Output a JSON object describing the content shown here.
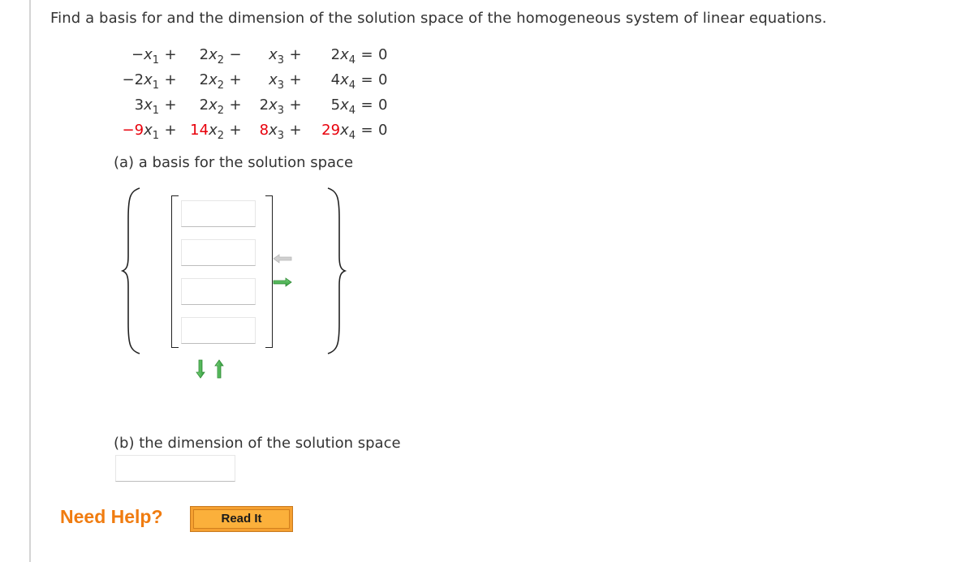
{
  "question": "Find a basis for and the dimension of the solution space of the homogeneous system of linear equations.",
  "equations": [
    {
      "terms": [
        {
          "coef": "−",
          "var": "x",
          "sub": "1",
          "red": false
        },
        {
          "op": "+",
          "coef": "2",
          "var": "x",
          "sub": "2",
          "red": false
        },
        {
          "op": "−",
          "coef": "",
          "var": "x",
          "sub": "3",
          "red": false
        },
        {
          "op": "+",
          "coef": "2",
          "var": "x",
          "sub": "4",
          "red": false
        }
      ],
      "rhs": "0"
    },
    {
      "terms": [
        {
          "coef": "−2",
          "var": "x",
          "sub": "1",
          "red": false
        },
        {
          "op": "+",
          "coef": "2",
          "var": "x",
          "sub": "2",
          "red": false
        },
        {
          "op": "+",
          "coef": "",
          "var": "x",
          "sub": "3",
          "red": false
        },
        {
          "op": "+",
          "coef": "4",
          "var": "x",
          "sub": "4",
          "red": false
        }
      ],
      "rhs": "0"
    },
    {
      "terms": [
        {
          "coef": "3",
          "var": "x",
          "sub": "1",
          "red": false
        },
        {
          "op": "+",
          "coef": "2",
          "var": "x",
          "sub": "2",
          "red": false
        },
        {
          "op": "+",
          "coef": "2",
          "var": "x",
          "sub": "3",
          "red": false
        },
        {
          "op": "+",
          "coef": "5",
          "var": "x",
          "sub": "4",
          "red": false
        }
      ],
      "rhs": "0"
    },
    {
      "terms": [
        {
          "coef": "−9",
          "var": "x",
          "sub": "1",
          "red": true
        },
        {
          "op": "+",
          "coef": "14",
          "var": "x",
          "sub": "2",
          "red": true
        },
        {
          "op": "+",
          "coef": "8",
          "var": "x",
          "sub": "3",
          "red": true
        },
        {
          "op": "+",
          "coef": "29",
          "var": "x",
          "sub": "4",
          "red": true
        }
      ],
      "rhs": "0"
    }
  ],
  "equals_sign": "=",
  "part_a": {
    "label": "(a) a basis for the solution space",
    "vector_inputs": [
      "",
      "",
      "",
      ""
    ],
    "controls": {
      "remove_vector": "arrow-left-icon",
      "add_vector": "arrow-right-icon",
      "remove_row": "arrow-down-icon",
      "add_row": "arrow-up-icon"
    }
  },
  "part_b": {
    "label": "(b) the dimension of the solution space",
    "value": ""
  },
  "help": {
    "label": "Need Help?",
    "read_it": "Read It"
  },
  "colors": {
    "highlight_red": "#e8000b",
    "help_orange": "#f07c10",
    "button_orange": "#fbb03b",
    "arrow_green": "#4caf50",
    "arrow_disabled": "#c8c8c8"
  }
}
